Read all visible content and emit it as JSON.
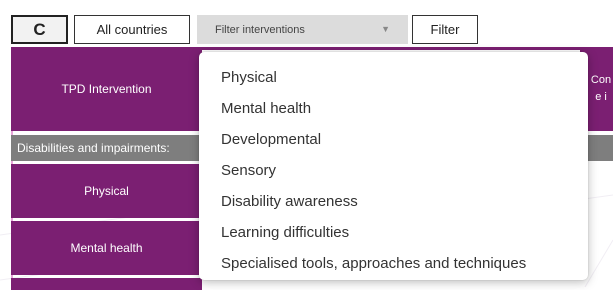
{
  "toolbar": {
    "refresh_glyph": "C",
    "all_countries_label": "All countries",
    "filter_select_value": "Filter interventions",
    "filter_button_label": "Filter"
  },
  "table": {
    "header_intervention": "TPD Intervention",
    "header_right_partial": "Con e i",
    "section_label": "Disabilities and impairments:",
    "rows": [
      "Physical",
      "Mental health"
    ]
  },
  "dropdown": {
    "options": [
      "Physical",
      "Mental health",
      "Developmental",
      "Sensory",
      "Disability awareness",
      "Learning difficulties",
      "Specialised tools, approaches and techniques"
    ]
  },
  "colors": {
    "accent_purple": "#7b1f72",
    "section_grey": "#7e7e7e",
    "select_grey": "#dcdcdc"
  }
}
